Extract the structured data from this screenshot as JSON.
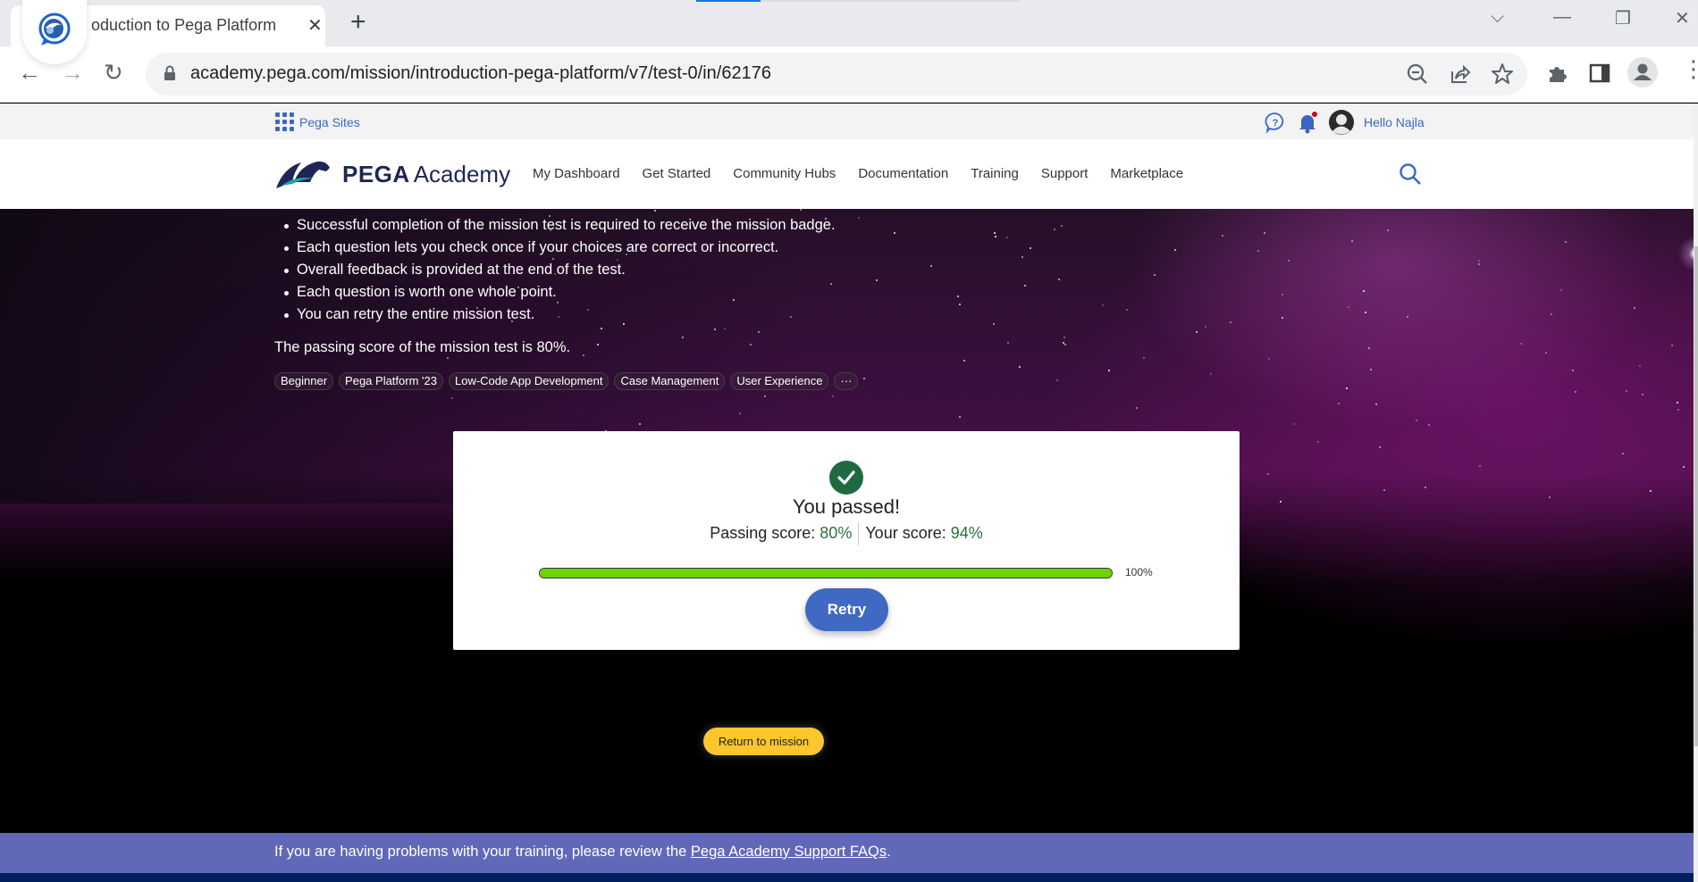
{
  "browser": {
    "tab_title": "oduction to Pega Platform | P",
    "url": "academy.pega.com/mission/introduction-pega-platform/v7/test-0/in/62176",
    "icons": {
      "favicon": "pega-chat-bubble-icon",
      "close_tab": "close-icon",
      "new_tab": "plus-icon",
      "back": "arrow-left-icon",
      "forward": "arrow-right-icon",
      "reload": "reload-icon",
      "lock": "lock-icon",
      "zoom": "zoom-out-icon",
      "share": "share-icon",
      "bookmark": "star-icon",
      "extensions": "puzzle-icon",
      "side_panel": "side-panel-icon",
      "profile": "profile-icon",
      "menu": "kebab-menu-icon"
    },
    "glyphs": {
      "close": "✕",
      "new_tab": "+",
      "back": "←",
      "forward": "→",
      "reload": "↻",
      "tab_search": "⌵",
      "minimize": "—",
      "restore": "❐",
      "window_close": "✕",
      "menu": "⋮"
    }
  },
  "utility_bar": {
    "pega_sites": "Pega Sites",
    "greeting": "Hello Najla",
    "notification_color": "#d0021b"
  },
  "nav": {
    "logo_pega": "PEGA",
    "logo_academy": "Academy",
    "links": [
      "My Dashboard",
      "Get Started",
      "Community Hubs",
      "Documentation",
      "Training",
      "Support",
      "Marketplace"
    ]
  },
  "hero": {
    "rules": [
      "Successful completion of the mission test is required to receive the mission badge.",
      "Each question lets you check once if your choices are correct or incorrect.",
      "Overall feedback is provided at the end of the test.",
      "Each question is worth one whole point.",
      "You can retry the entire mission test."
    ],
    "passing_note": "The passing score of the mission test is 80%.",
    "tags": [
      "Beginner",
      "Pega Platform '23",
      "Low-Code App Development",
      "Case Management",
      "User Experience"
    ],
    "more_tags": "···"
  },
  "result": {
    "title": "You passed!",
    "passing_label": "Passing score:",
    "passing_value": "80%",
    "your_label": "Your score:",
    "your_value": "94%",
    "progress_percent": 100,
    "progress_label": "100%",
    "retry_label": "Retry",
    "success_color": "#1f6b41",
    "progress_color": "#6dd400"
  },
  "return_label": "Return to mission",
  "footer": {
    "text": "If you are having problems with your training, please review the ",
    "link": "Pega Academy Support FAQs",
    "suffix": "."
  }
}
